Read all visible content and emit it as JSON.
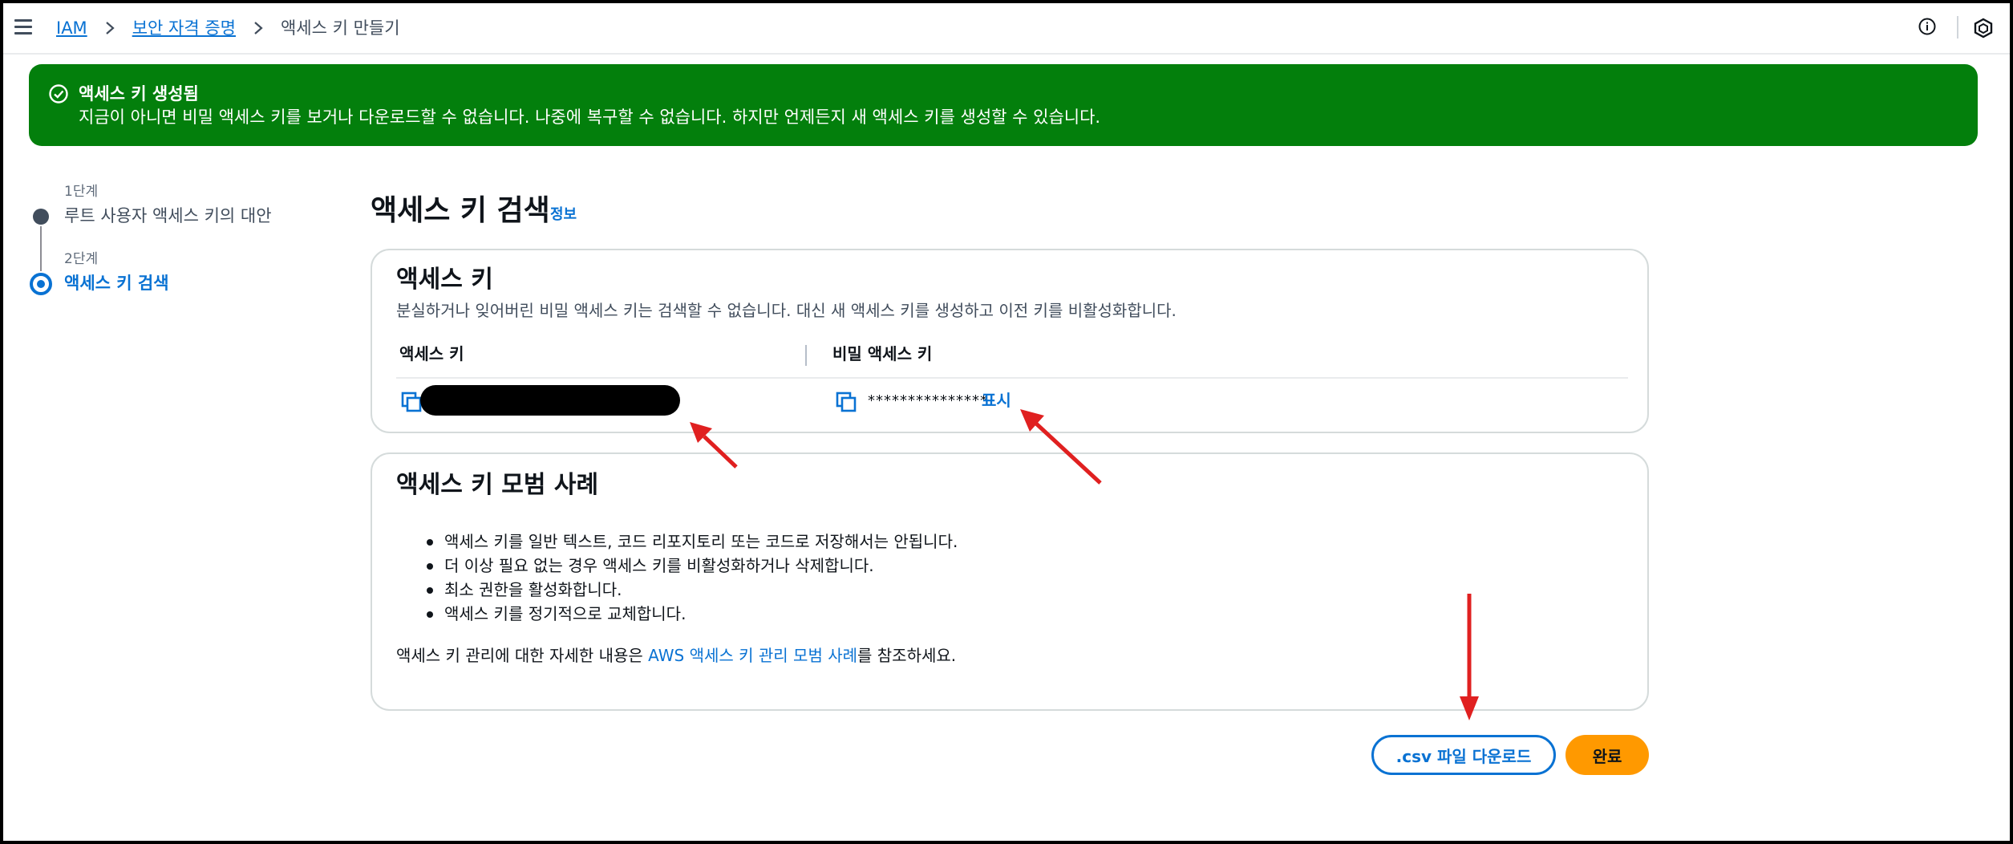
{
  "breadcrumb": {
    "items": [
      "IAM",
      "보안 자격 증명"
    ],
    "current": "액세스 키 만들기"
  },
  "flash": {
    "title": "액세스 키 생성됨",
    "message": "지금이 아니면 비밀 액세스 키를 보거나 다운로드할 수 없습니다. 나중에 복구할 수 없습니다. 하지만 언제든지 새 액세스 키를 생성할 수 있습니다."
  },
  "steps": [
    {
      "number": "1단계",
      "label": "루트 사용자 액세스 키의 대안"
    },
    {
      "number": "2단계",
      "label": "액세스 키 검색"
    }
  ],
  "page": {
    "title": "액세스 키 검색",
    "info_link": "정보"
  },
  "access_key_panel": {
    "title": "액세스 키",
    "description": "분실하거나 잊어버린 비밀 액세스 키는 검색할 수 없습니다. 대신 새 액세스 키를 생성하고 이전 키를 비활성화합니다.",
    "col_access_key": "액세스 키",
    "col_secret_key": "비밀 액세스 키",
    "secret_masked": "***************",
    "show_label": "표시"
  },
  "best_practices": {
    "title": "액세스 키 모범 사례",
    "items": [
      "액세스 키를 일반 텍스트, 코드 리포지토리 또는 코드로 저장해서는 안됩니다.",
      "더 이상 필요 없는 경우 액세스 키를 비활성화하거나 삭제합니다.",
      "최소 권한을 활성화합니다.",
      "액세스 키를 정기적으로 교체합니다."
    ],
    "footer_prefix": "액세스 키 관리에 대한 자세한 내용은 ",
    "footer_link": "AWS 액세스 키 관리 모범 사례",
    "footer_suffix": "를 참조하세요."
  },
  "buttons": {
    "csv": ".csv 파일 다운로드",
    "done": "완료"
  },
  "colors": {
    "success": "#037f0c",
    "link": "#0972d3",
    "primary": "#ff9900",
    "annotation": "#e02020"
  }
}
